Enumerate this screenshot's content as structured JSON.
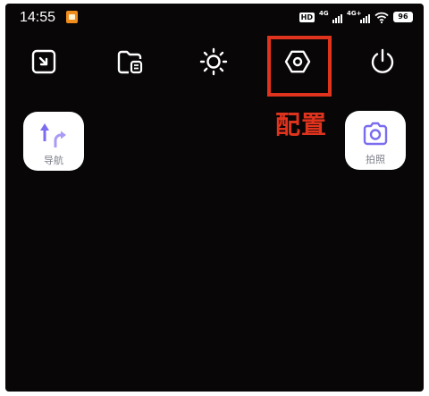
{
  "status_bar": {
    "time": "14:55",
    "notification_icon": "app-notification-icon",
    "network_badge": "HD",
    "signal_1": "4G",
    "signal_2": "4G+",
    "battery": "96"
  },
  "toolbar": {
    "items": [
      {
        "name": "screenshot",
        "icon": "screenshot-icon"
      },
      {
        "name": "files",
        "icon": "folder-icon"
      },
      {
        "name": "brightness",
        "icon": "brightness-icon"
      },
      {
        "name": "settings",
        "icon": "settings-hexagon-icon"
      },
      {
        "name": "power",
        "icon": "power-icon"
      }
    ]
  },
  "annotation": {
    "label": "配置",
    "color": "#e0331d"
  },
  "tiles": {
    "navigation": {
      "label": "导航",
      "icon": "navigation-arrow-icon",
      "accent": "#7b6cf0"
    },
    "camera": {
      "label": "拍照",
      "icon": "camera-icon",
      "accent": "#7b6cf0"
    }
  }
}
